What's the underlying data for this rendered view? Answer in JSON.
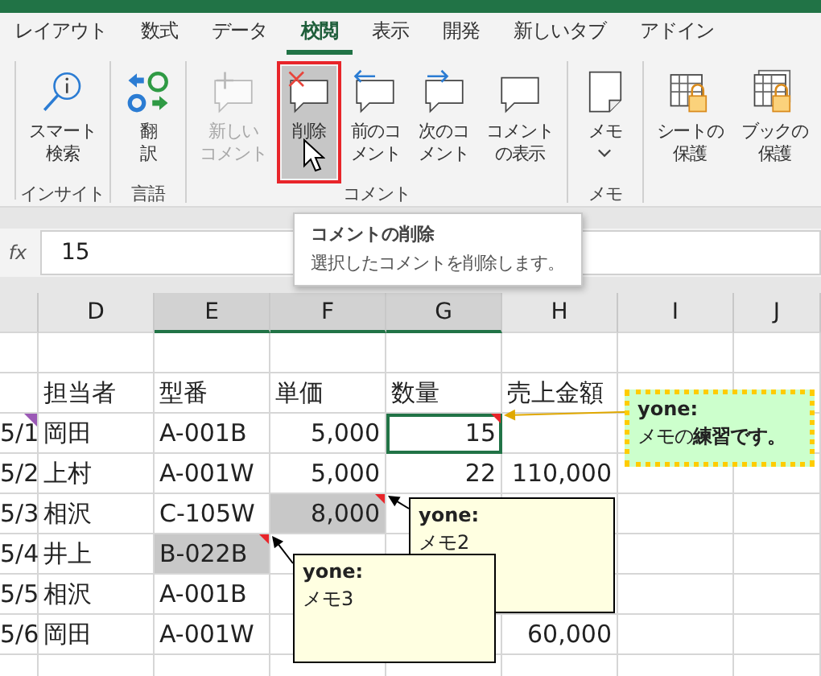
{
  "tabs": [
    {
      "label": "レイアウト",
      "selected": false
    },
    {
      "label": "数式",
      "selected": false
    },
    {
      "label": "データ",
      "selected": false
    },
    {
      "label": "校閲",
      "selected": true
    },
    {
      "label": "表示",
      "selected": false
    },
    {
      "label": "開発",
      "selected": false
    },
    {
      "label": "新しいタブ",
      "selected": false
    },
    {
      "label": "アドイン",
      "selected": false
    }
  ],
  "ribbon_groups": [
    {
      "label": "インサイト",
      "buttons": [
        {
          "lines": [
            "スマート",
            "検索"
          ],
          "kind": "search",
          "disabled": false,
          "selected": false,
          "highlighted": false
        }
      ]
    },
    {
      "label": "言語",
      "buttons": [
        {
          "lines": [
            "翻",
            "訳"
          ],
          "kind": "translate",
          "disabled": false,
          "selected": false,
          "highlighted": false
        }
      ]
    },
    {
      "label": "コメント",
      "buttons": [
        {
          "lines": [
            "新しい",
            "コメント"
          ],
          "kind": "new_comment",
          "disabled": true,
          "selected": false,
          "highlighted": false
        },
        {
          "lines": [
            "削除"
          ],
          "kind": "delete_comment",
          "disabled": false,
          "selected": true,
          "highlighted": true
        },
        {
          "lines": [
            "前のコ",
            "メント"
          ],
          "kind": "prev_comment",
          "disabled": false,
          "selected": false,
          "highlighted": false
        },
        {
          "lines": [
            "次のコ",
            "メント"
          ],
          "kind": "next_comment",
          "disabled": false,
          "selected": false,
          "highlighted": false
        },
        {
          "lines": [
            "コメント",
            "の表示"
          ],
          "kind": "show_comments",
          "disabled": false,
          "selected": false,
          "highlighted": false
        }
      ]
    },
    {
      "label": "メモ",
      "buttons": [
        {
          "lines": [
            "メモ"
          ],
          "kind": "note",
          "disabled": false,
          "selected": false,
          "highlighted": false
        }
      ]
    },
    {
      "buttons": [
        {
          "lines": [
            "シートの",
            "保護"
          ],
          "kind": "protect_sheet",
          "disabled": false,
          "selected": false,
          "highlighted": false
        },
        {
          "lines": [
            "ブックの",
            "保護"
          ],
          "kind": "protect_book",
          "disabled": false,
          "selected": false,
          "highlighted": false
        }
      ]
    }
  ],
  "tooltip": {
    "title": "コメントの削除",
    "description": "選択したコメントを削除します。"
  },
  "formula_bar": {
    "function_label": "fx",
    "value": "15"
  },
  "columns": [
    {
      "label": "D",
      "selected": false
    },
    {
      "label": "E",
      "selected": true
    },
    {
      "label": "F",
      "selected": true
    },
    {
      "label": "G",
      "selected": true
    },
    {
      "label": "H",
      "selected": false
    },
    {
      "label": "I",
      "selected": false
    },
    {
      "label": "J",
      "selected": false
    }
  ],
  "header_row": [
    "担当者",
    "型番",
    "単価",
    "数量",
    "売上金額"
  ],
  "rows": [
    {
      "cells": [
        {
          "text": "5/1",
          "selected": false,
          "active": false,
          "marker": {
            "color": "#9b59b6"
          }
        },
        {
          "text": "岡田",
          "selected": false,
          "active": false
        },
        {
          "text": "A-001B",
          "selected": false,
          "active": false
        },
        {
          "text": "5,000",
          "selected": false,
          "active": false
        },
        {
          "text": "15",
          "selected": false,
          "active": true,
          "marker": {
            "color": "#e8252a"
          }
        },
        {
          "selected": false,
          "active": false
        }
      ]
    },
    {
      "cells": [
        {
          "text": "5/2",
          "selected": false,
          "active": false
        },
        {
          "text": "上村",
          "selected": false,
          "active": false
        },
        {
          "text": "A-001W",
          "selected": false,
          "active": false
        },
        {
          "text": "5,000",
          "selected": false,
          "active": false
        },
        {
          "text": "22",
          "selected": false,
          "active": false
        },
        {
          "text": "110,000",
          "selected": false,
          "active": false
        }
      ]
    },
    {
      "cells": [
        {
          "text": "5/3",
          "selected": false,
          "active": false
        },
        {
          "text": "相沢",
          "selected": false,
          "active": false
        },
        {
          "text": "C-105W",
          "selected": false,
          "active": false
        },
        {
          "text": "8,000",
          "selected": true,
          "active": false,
          "marker": {
            "color": "#e8252a"
          }
        },
        null,
        null
      ]
    },
    {
      "cells": [
        {
          "text": "5/4",
          "selected": false,
          "active": false
        },
        {
          "text": "井上",
          "selected": false,
          "active": false
        },
        {
          "text": "B-022B",
          "selected": true,
          "active": false,
          "marker": {
            "color": "#e8252a"
          }
        },
        null,
        null,
        null
      ]
    },
    {
      "cells": [
        {
          "text": "5/5",
          "selected": false,
          "active": false
        },
        {
          "text": "相沢",
          "selected": false,
          "active": false
        },
        {
          "text": "A-001B",
          "selected": false,
          "active": false
        },
        null,
        null,
        null
      ]
    },
    {
      "cells": [
        {
          "text": "5/6",
          "selected": false,
          "active": false
        },
        {
          "text": "岡田",
          "selected": false,
          "active": false
        },
        {
          "text": "A-001W",
          "selected": false,
          "active": false
        },
        null,
        null,
        {
          "text": "60,000",
          "selected": false,
          "active": false
        }
      ]
    }
  ],
  "comments": [
    {
      "kind": "styled",
      "author": "yone:",
      "text": "メモの**練習です。**"
    },
    {
      "kind": "plain",
      "author": "yone:",
      "text": "メモ2"
    },
    {
      "kind": "plain",
      "author": "yone:",
      "text": "メモ3"
    }
  ]
}
